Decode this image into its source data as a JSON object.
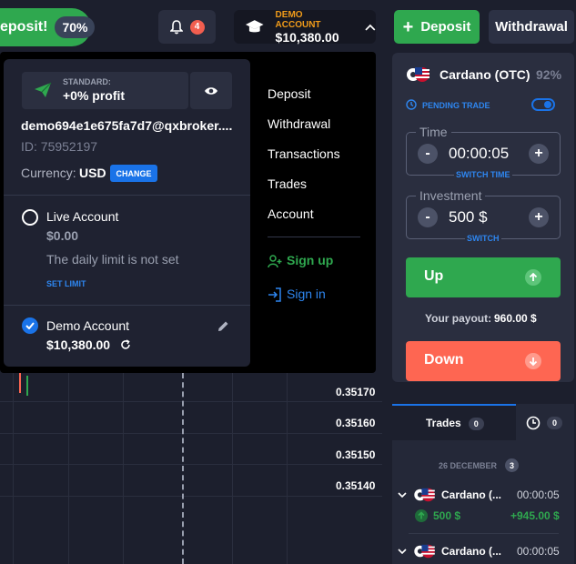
{
  "topbar": {
    "promo_text": "eposit!",
    "promo_pct": "70%",
    "notif_count": "4",
    "account_label": "DEMO ACCOUNT",
    "account_balance": "$10,380.00",
    "deposit_label": "Deposit",
    "withdrawal_label": "Withdrawal"
  },
  "chart": {
    "prices": [
      "0.35170",
      "0.35160",
      "0.35150",
      "0.35140"
    ]
  },
  "account_menu": {
    "plan_label": "STANDARD:",
    "plan_value": "+0% profit",
    "email": "demo694e1e675fa7d7@qxbroker....",
    "id": "ID: 75952197",
    "currency_label": "Currency:",
    "currency_value": "USD",
    "change_label": "CHANGE",
    "live_title": "Live Account",
    "live_balance": "$0.00",
    "live_limit": "The daily limit is not set",
    "set_limit": "SET LIMIT",
    "demo_title": "Demo Account",
    "demo_balance": "$10,380.00"
  },
  "side_menu": {
    "items": [
      "Deposit",
      "Withdrawal",
      "Transactions",
      "Trades",
      "Account"
    ],
    "signup": "Sign up",
    "signin": "Sign in"
  },
  "trade_panel": {
    "asset": "Cardano (OTC)",
    "payout_pct": "92%",
    "pending": "PENDING TRADE",
    "time_label": "Time",
    "time_value": "00:00:05",
    "switch_time": "SWITCH TIME",
    "investment_label": "Investment",
    "investment_value": "500 $",
    "switch": "SWITCH",
    "up_label": "Up",
    "payout_label": "Your payout:",
    "payout_value": "960.00 $",
    "down_label": "Down"
  },
  "trades": {
    "tab_trades": "Trades",
    "tab_trades_count": "0",
    "tab_hist_count": "0",
    "date": "26 DECEMBER",
    "date_count": "3",
    "rows": [
      {
        "asset": "Cardano (...",
        "time": "00:00:05",
        "amount": "500 $",
        "profit": "+945.00 $"
      },
      {
        "asset": "Cardano (...",
        "time": "00:00:05"
      }
    ]
  },
  "colors": {
    "green": "#2fa84f",
    "red": "#fe6652",
    "blue": "#1a73e8",
    "orange": "#f09b1a"
  }
}
